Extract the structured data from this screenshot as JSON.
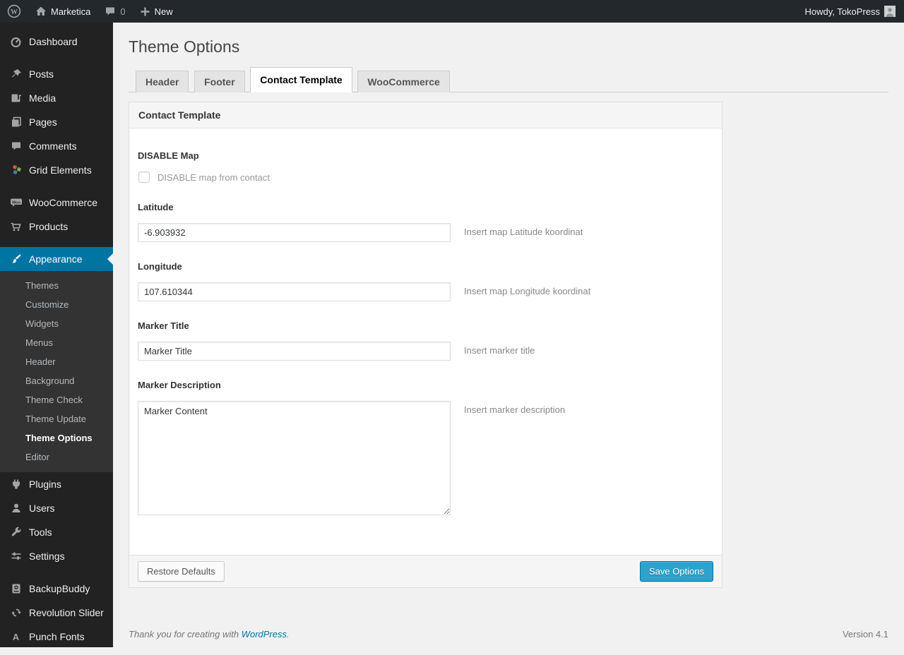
{
  "colors": {
    "accent": "#0074a2",
    "primary_button": "#2ea2cc",
    "link": "#0074a2",
    "admin_bar_bg": "#23282d",
    "sidebar_bg": "#222222"
  },
  "admin_bar": {
    "site_name": "Marketica",
    "comment_count": "0",
    "new_label": "New",
    "howdy": "Howdy, TokoPress"
  },
  "sidebar": {
    "top": [
      "Dashboard",
      "Posts",
      "Media",
      "Pages",
      "Comments",
      "Grid Elements"
    ],
    "commerce": [
      "WooCommerce",
      "Products"
    ],
    "appearance": {
      "label": "Appearance",
      "submenu": [
        "Themes",
        "Customize",
        "Widgets",
        "Menus",
        "Header",
        "Background",
        "Theme Check",
        "Theme Update",
        "Theme Options",
        "Editor"
      ],
      "current": "Theme Options"
    },
    "admin": [
      "Plugins",
      "Users",
      "Tools",
      "Settings"
    ],
    "plugins": [
      "BackupBuddy",
      "Revolution Slider",
      "Punch Fonts"
    ]
  },
  "page": {
    "title": "Theme Options",
    "tabs": [
      "Header",
      "Footer",
      "Contact Template",
      "WooCommerce"
    ],
    "active_tab": "Contact Template"
  },
  "panel": {
    "header": "Contact Template",
    "fields": {
      "disable_map": {
        "label": "DISABLE Map",
        "checkbox_label": "DISABLE map from contact",
        "checked": false
      },
      "latitude": {
        "label": "Latitude",
        "value": "-6.903932",
        "help": "Insert map Latitude koordinat"
      },
      "longitude": {
        "label": "Longitude",
        "value": "107.610344",
        "help": "Insert map Longitude koordinat"
      },
      "marker_title": {
        "label": "Marker Title",
        "value": "Marker Title",
        "help": "Insert marker title"
      },
      "marker_description": {
        "label": "Marker Description",
        "value": "Marker Content",
        "help": "Insert marker description"
      }
    },
    "footer": {
      "restore_label": "Restore Defaults",
      "save_label": "Save Options"
    }
  },
  "page_footer": {
    "thanks_prefix": "Thank you for creating with ",
    "wordpress_link": "WordPress",
    "thanks_suffix": ".",
    "version": "Version 4.1"
  },
  "icons": {
    "wordpress-logo-icon": "W in circle",
    "home-icon": "house shape",
    "comments-bubble-icon": "speech bubble",
    "plus-icon": "plus cross",
    "dashboard-icon": "gauge",
    "posts-icon": "pushpin",
    "media-icon": "card with music note",
    "pages-icon": "stacked pages",
    "grid-elements-icon": "three colored diamonds",
    "woocommerce-icon": "Woo badge bubble",
    "products-icon": "shopping cart",
    "appearance-icon": "paint brush",
    "plugins-icon": "power plug",
    "users-icon": "person silhouette",
    "tools-icon": "wrench",
    "settings-icon": "slider controls",
    "backupbuddy-icon": "backup box",
    "revolution-slider-icon": "cycle arrows",
    "punch-fonts-icon": "letter A",
    "avatar": "person placeholder"
  }
}
